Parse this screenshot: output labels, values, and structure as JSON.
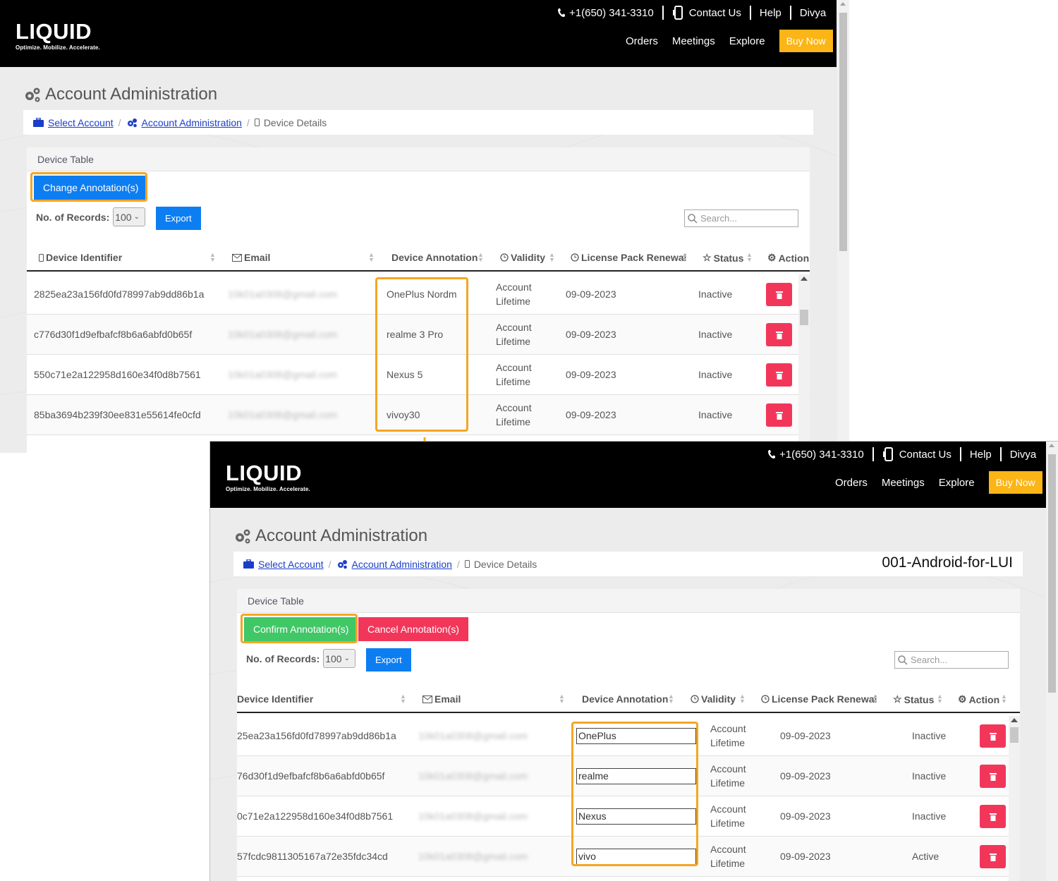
{
  "header": {
    "logo_text": "LIQUID",
    "logo_tagline": "Optimize. Mobilize. Accelerate.",
    "phone": "+1(650) 341-3310",
    "contact": "Contact Us",
    "help": "Help",
    "user": "Divya",
    "nav": [
      "Orders",
      "Meetings",
      "Explore"
    ],
    "buy_now": "Buy Now"
  },
  "page": {
    "title": "Account Administration",
    "breadcrumb": {
      "select_account": "Select Account",
      "account_admin": "Account Administration",
      "device_details": "Device Details",
      "account_name": "001-Android-for-LUI"
    },
    "panel_title": "Device Table",
    "records_label": "No. of Records:",
    "records_value": "100",
    "export": "Export",
    "search_placeholder": "Search..."
  },
  "buttons": {
    "change_annotation": "Change Annotation(s)",
    "confirm_annotation": "Confirm Annotation(s)",
    "cancel_annotation": "Cancel Annotation(s)"
  },
  "columns": {
    "device_identifier": "Device Identifier",
    "email": "Email",
    "device_annotation": "Device Annotation",
    "validity": "Validity",
    "license_renewal": "License Pack Renewal",
    "status": "Status",
    "action": "Action"
  },
  "table_before": [
    {
      "id": "2825ea23a156fd0fd78997ab9dd86b1a",
      "email": "10k01a0308@gmail.com",
      "annotation": "OnePlus Nordm",
      "validity1": "Account",
      "validity2": "Lifetime",
      "renewal": "09-09-2023",
      "status": "Inactive"
    },
    {
      "id": "c776d30f1d9efbafcf8b6a6abfd0b65f",
      "email": "10k01a0308@gmail.com",
      "annotation": "realme 3 Pro",
      "validity1": "Account",
      "validity2": "Lifetime",
      "renewal": "09-09-2023",
      "status": "Inactive"
    },
    {
      "id": "550c71e2a122958d160e34f0d8b7561",
      "email": "10k01a0308@gmail.com",
      "annotation": "Nexus 5",
      "validity1": "Account",
      "validity2": "Lifetime",
      "renewal": "09-09-2023",
      "status": "Inactive"
    },
    {
      "id": "85ba3694b239f30ee831e55614fe0cfd",
      "email": "10k01a0308@gmail.com",
      "annotation": "vivoy30",
      "validity1": "Account",
      "validity2": "Lifetime",
      "renewal": "09-09-2023",
      "status": "Inactive"
    }
  ],
  "table_after": [
    {
      "id": "25ea23a156fd0fd78997ab9dd86b1a",
      "email": "10k01a0308@gmail.com",
      "annotation": "OnePlus",
      "validity1": "Account",
      "validity2": "Lifetime",
      "renewal": "09-09-2023",
      "status": "Inactive"
    },
    {
      "id": "76d30f1d9efbafcf8b6a6abfd0b65f",
      "email": "10k01a0308@gmail.com",
      "annotation": "realme",
      "validity1": "Account",
      "validity2": "Lifetime",
      "renewal": "09-09-2023",
      "status": "Inactive"
    },
    {
      "id": "0c71e2a122958d160e34f0d8b7561",
      "email": "10k01a0308@gmail.com",
      "annotation": "Nexus",
      "validity1": "Account",
      "validity2": "Lifetime",
      "renewal": "09-09-2023",
      "status": "Inactive"
    },
    {
      "id": "57fcdc9811305167a72e35fdc34cd",
      "email": "10k01a0308@gmail.com",
      "annotation": "vivo",
      "validity1": "Account",
      "validity2": "Lifetime",
      "renewal": "09-09-2023",
      "status": "Active"
    }
  ],
  "colors": {
    "primary_blue": "#0d7ef2",
    "danger_red": "#f2365a",
    "success_green": "#40c766",
    "highlight_orange": "#f5a623",
    "buy_yellow": "#fbb516"
  }
}
